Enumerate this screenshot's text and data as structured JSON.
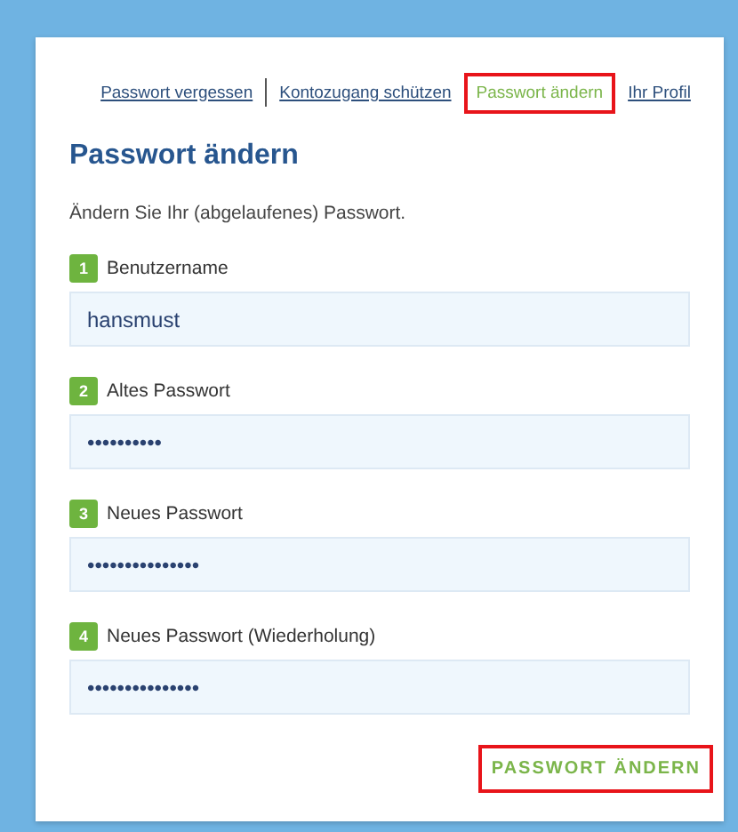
{
  "nav": [
    {
      "label": "Passwort vergessen",
      "selected": false,
      "highlighted": false
    },
    {
      "label": "Kontozugang schützen",
      "selected": false,
      "highlighted": false
    },
    {
      "label": "Passwort ändern",
      "selected": true,
      "highlighted": true
    },
    {
      "label": "Ihr Profil",
      "selected": false,
      "highlighted": false
    }
  ],
  "title": "Passwort ändern",
  "description": "Ändern Sie Ihr (abgelaufenes) Passwort.",
  "fields": [
    {
      "number": "1",
      "label": "Benutzername",
      "value": "hansmust"
    },
    {
      "number": "2",
      "label": "Altes Passwort",
      "value": "••••••••••"
    },
    {
      "number": "3",
      "label": "Neues Passwort",
      "value": "•••••••••••••••"
    },
    {
      "number": "4",
      "label": "Neues Passwort (Wiederholung)",
      "value": "•••••••••••••••"
    }
  ],
  "submit": {
    "label": "PASSWORT ÄNDERN",
    "highlighted": true
  }
}
